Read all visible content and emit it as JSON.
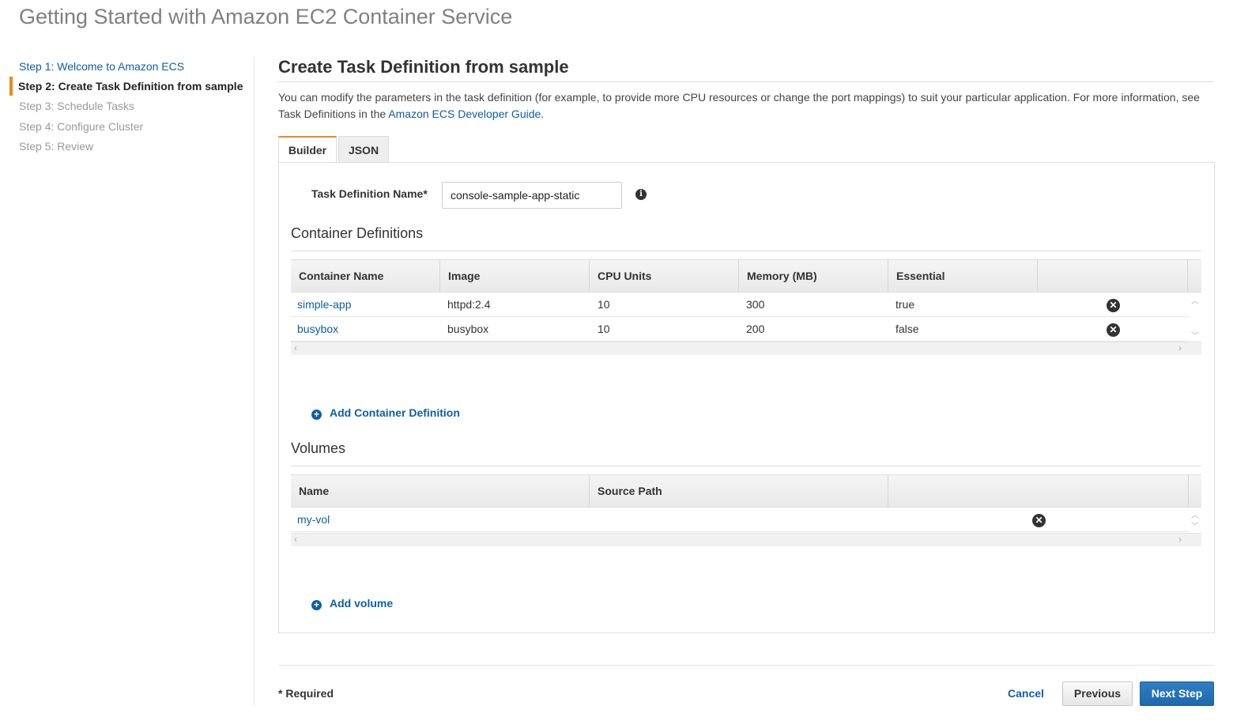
{
  "header": {
    "title": "Getting Started with Amazon EC2 Container Service"
  },
  "sidebar": {
    "steps": [
      {
        "label": "Step 1: Welcome to Amazon ECS",
        "state": "link"
      },
      {
        "label": "Step 2: Create Task Definition from sample",
        "state": "active"
      },
      {
        "label": "Step 3: Schedule Tasks",
        "state": "disabled"
      },
      {
        "label": "Step 4: Configure Cluster",
        "state": "disabled"
      },
      {
        "label": "Step 5: Review",
        "state": "disabled"
      }
    ]
  },
  "main": {
    "title": "Create Task Definition from sample",
    "intro_text": "You can modify the parameters in the task definition (for example, to provide more CPU resources or change the port mappings) to suit your particular application. For more information, see Task Definitions in the ",
    "intro_link": "Amazon ECS Developer Guide",
    "intro_end": ".",
    "tabs": [
      {
        "label": "Builder",
        "active": true
      },
      {
        "label": "JSON",
        "active": false
      }
    ],
    "task_definition": {
      "label": "Task Definition Name*",
      "value": "console-sample-app-static",
      "info_icon": "i"
    },
    "container_definitions": {
      "title": "Container Definitions",
      "columns": [
        "Container Name",
        "Image",
        "CPU Units",
        "Memory (MB)",
        "Essential"
      ],
      "rows": [
        {
          "name": "simple-app",
          "image": "httpd:2.4",
          "cpu": "10",
          "memory": "300",
          "essential": "true"
        },
        {
          "name": "busybox",
          "image": "busybox",
          "cpu": "10",
          "memory": "200",
          "essential": "false"
        }
      ],
      "add_label": "Add Container Definition"
    },
    "volumes": {
      "title": "Volumes",
      "columns": [
        "Name",
        "Source Path"
      ],
      "rows": [
        {
          "name": "my-vol",
          "source_path": ""
        }
      ],
      "add_label": "Add volume"
    }
  },
  "footer": {
    "required_note": "* Required",
    "cancel_label": "Cancel",
    "previous_label": "Previous",
    "next_label": "Next Step"
  },
  "icons": {
    "add": "plus-circle-icon",
    "remove": "remove-circle-icon",
    "info": "info-icon"
  },
  "colors": {
    "link": "#0f5ea8",
    "accent": "#e98b1d",
    "primary_button": "#1f68ad"
  }
}
